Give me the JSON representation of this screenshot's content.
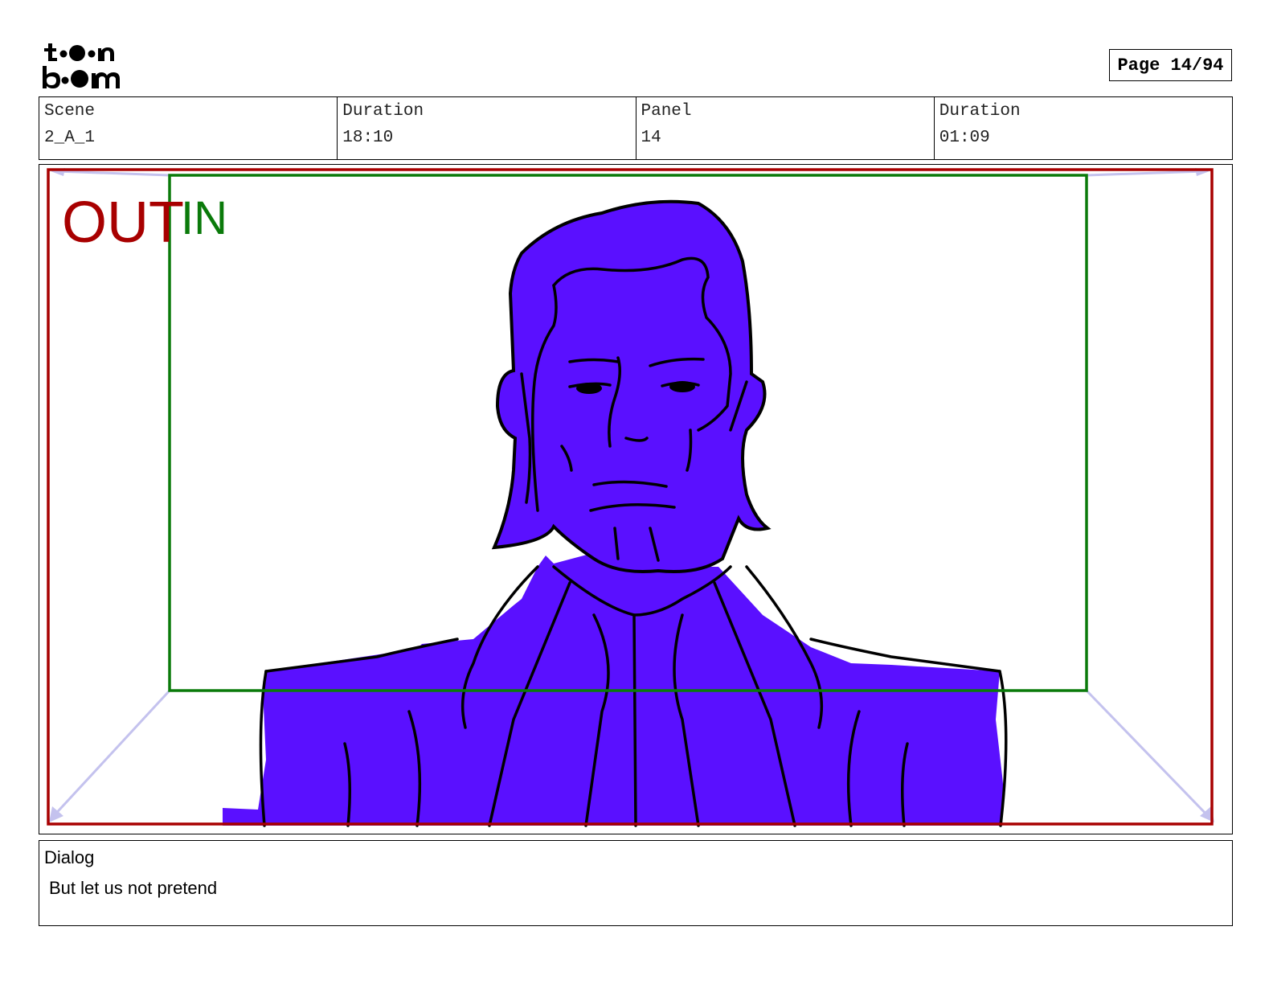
{
  "header": {
    "logo_text": "toon boom",
    "page_indicator": "Page 14/94"
  },
  "info": {
    "scene_label": "Scene",
    "scene_value": "2_A_1",
    "scene_duration_label": "Duration",
    "scene_duration_value": "18:10",
    "panel_label": "Panel",
    "panel_value": "14",
    "panel_duration_label": "Duration",
    "panel_duration_value": "01:09"
  },
  "frame": {
    "out_label": "OUT",
    "in_label": "IN",
    "out_color": "#a80000",
    "in_color": "#0a7a0a",
    "fill_color": "#5a10ff"
  },
  "dialog": {
    "label": "Dialog",
    "text": "But let us not pretend"
  }
}
